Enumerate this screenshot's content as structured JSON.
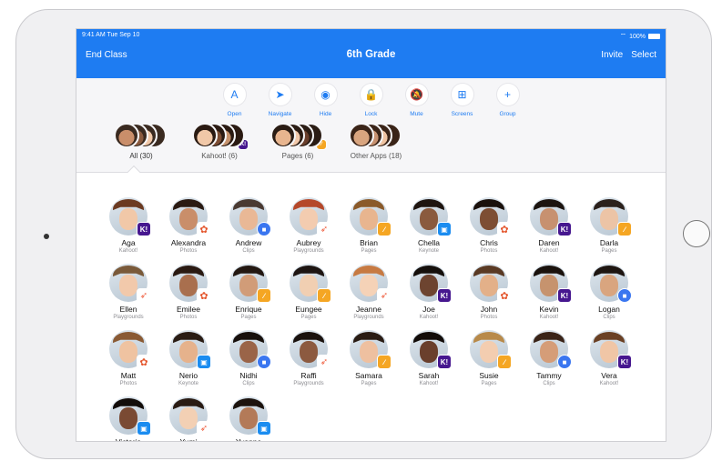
{
  "status": {
    "time": "9:41 AM  Tue Sep 10",
    "battery": "100%"
  },
  "nav": {
    "left": "End Class",
    "title": "6th Grade",
    "invite": "Invite",
    "select": "Select"
  },
  "tools": [
    {
      "label": "Open",
      "icon": "app-store-icon",
      "glyph": "A"
    },
    {
      "label": "Navigate",
      "icon": "compass-icon",
      "glyph": "➤"
    },
    {
      "label": "Hide",
      "icon": "eye-slash-icon",
      "glyph": "◉"
    },
    {
      "label": "Lock",
      "icon": "lock-icon",
      "glyph": "🔒"
    },
    {
      "label": "Mute",
      "icon": "bell-slash-icon",
      "glyph": "🔕"
    },
    {
      "label": "Screens",
      "icon": "binoculars-icon",
      "glyph": "⊞"
    },
    {
      "label": "Group",
      "icon": "plus-icon",
      "glyph": "+"
    }
  ],
  "groups": [
    {
      "label": "All (30)",
      "badge": ""
    },
    {
      "label": "Kahoot! (6)",
      "badge": "K!"
    },
    {
      "label": "Pages (6)",
      "badge": ""
    },
    {
      "label": "Other Apps (18)",
      "badge": ""
    }
  ],
  "students": [
    {
      "name": "Aga",
      "app": "Kahoot!",
      "badge": "kahoot",
      "skin": "#f1c8a8",
      "hair": "#6b3a21"
    },
    {
      "name": "Alexandra",
      "app": "Photos",
      "badge": "photos",
      "skin": "#c98e6a",
      "hair": "#2a1a12"
    },
    {
      "name": "Andrew",
      "app": "Clips",
      "badge": "clips",
      "skin": "#e9b896",
      "hair": "#4a3a32"
    },
    {
      "name": "Aubrey",
      "app": "Playgrounds",
      "badge": "play",
      "skin": "#f3ccb0",
      "hair": "#b5482a"
    },
    {
      "name": "Brian",
      "app": "Pages",
      "badge": "pages",
      "skin": "#e8b58f",
      "hair": "#8a5a2a"
    },
    {
      "name": "Chella",
      "app": "Keynote",
      "badge": "key",
      "skin": "#8a5a3e",
      "hair": "#1e140f"
    },
    {
      "name": "Chris",
      "app": "Photos",
      "badge": "photos",
      "skin": "#7d4e34",
      "hair": "#1a110c"
    },
    {
      "name": "Daren",
      "app": "Kahoot!",
      "badge": "kahoot",
      "skin": "#c79170",
      "hair": "#1c1410"
    },
    {
      "name": "Darla",
      "app": "Pages",
      "badge": "pages",
      "skin": "#ecc4a6",
      "hair": "#2b211c"
    },
    {
      "name": "Ellen",
      "app": "Playgrounds",
      "badge": "play",
      "skin": "#f2c9ab",
      "hair": "#7a5a3a"
    },
    {
      "name": "Emilee",
      "app": "Photos",
      "badge": "photos",
      "skin": "#a96f4e",
      "hair": "#2a1a12"
    },
    {
      "name": "Enrique",
      "app": "Pages",
      "badge": "pages",
      "skin": "#d19c78",
      "hair": "#231812"
    },
    {
      "name": "Eungee",
      "app": "Pages",
      "badge": "pages",
      "skin": "#f1cfb2",
      "hair": "#1d1512"
    },
    {
      "name": "Jeanne",
      "app": "Playgrounds",
      "badge": "play",
      "skin": "#f5d2b7",
      "hair": "#c77a42"
    },
    {
      "name": "Joe",
      "app": "Kahoot!",
      "badge": "kahoot",
      "skin": "#6d4430",
      "hair": "#15100c"
    },
    {
      "name": "John",
      "app": "Photos",
      "badge": "photos",
      "skin": "#e3b089",
      "hair": "#5a3a24"
    },
    {
      "name": "Kevin",
      "app": "Kahoot!",
      "badge": "kahoot",
      "skin": "#c6936e",
      "hair": "#1a120d"
    },
    {
      "name": "Logan",
      "app": "Clips",
      "badge": "clips",
      "skin": "#d9a57f",
      "hair": "#1e1611"
    },
    {
      "name": "Matt",
      "app": "Photos",
      "badge": "photos",
      "skin": "#efc3a1",
      "hair": "#8a5a34"
    },
    {
      "name": "Nerio",
      "app": "Keynote",
      "badge": "key",
      "skin": "#e6b28c",
      "hair": "#2a1c14"
    },
    {
      "name": "Nidhi",
      "app": "Clips",
      "badge": "clips",
      "skin": "#9a6448",
      "hair": "#17100c"
    },
    {
      "name": "Raffi",
      "app": "Playgrounds",
      "badge": "play",
      "skin": "#8c5a40",
      "hair": "#1a120e"
    },
    {
      "name": "Samara",
      "app": "Pages",
      "badge": "pages",
      "skin": "#eec0a0",
      "hair": "#2a1c14"
    },
    {
      "name": "Sarah",
      "app": "Kahoot!",
      "badge": "kahoot",
      "skin": "#6a3f2c",
      "hair": "#120c09"
    },
    {
      "name": "Susie",
      "app": "Pages",
      "badge": "pages",
      "skin": "#f3cdb0",
      "hair": "#b88a4a"
    },
    {
      "name": "Tammy",
      "app": "Clips",
      "badge": "clips",
      "skin": "#d59d78",
      "hair": "#3a2418"
    },
    {
      "name": "Vera",
      "app": "Kahoot!",
      "badge": "kahoot",
      "skin": "#f0c6a6",
      "hair": "#6a4024"
    },
    {
      "name": "Victoria",
      "app": "",
      "badge": "key",
      "skin": "#7a4a33",
      "hair": "#130d0a"
    },
    {
      "name": "Yumi",
      "app": "",
      "badge": "play",
      "skin": "#f3d0b4",
      "hair": "#2a1c14"
    },
    {
      "name": "Yvonne",
      "app": "",
      "badge": "key",
      "skin": "#b37a58",
      "hair": "#1c130e"
    }
  ],
  "badge_icons": {
    "kahoot": "K!",
    "photos": "✿",
    "clips": "■",
    "play": "➶",
    "pages": "∕",
    "key": "▣"
  },
  "colors": {
    "accent": "#1e7cf2",
    "kahoot": "#46178f",
    "pages": "#f5a623"
  }
}
